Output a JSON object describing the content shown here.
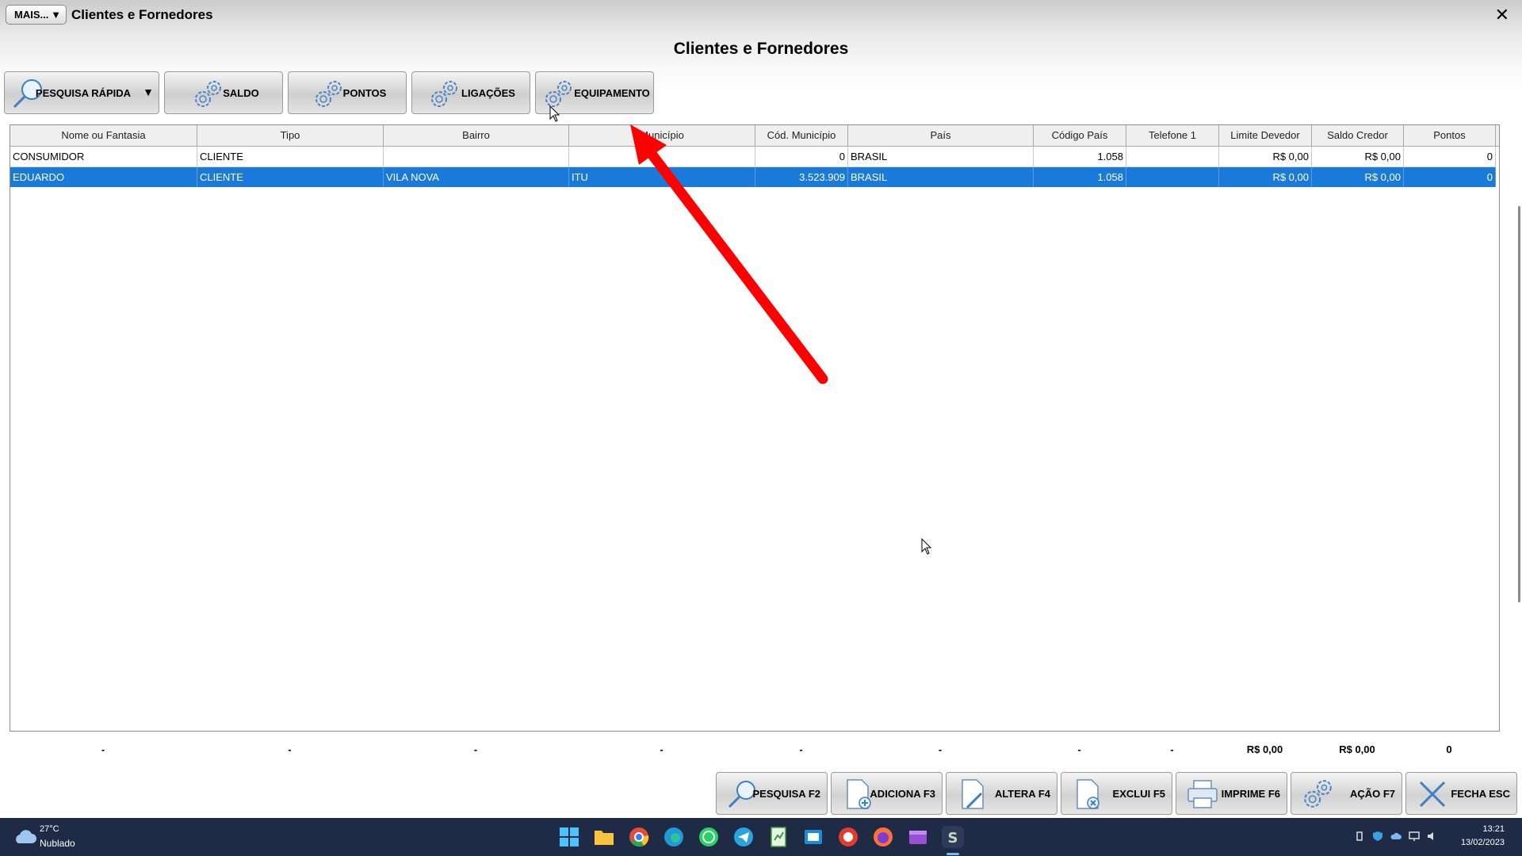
{
  "window": {
    "mais_label": "MAIS...",
    "title": "Clientes e Fornedores",
    "close_symbol": "✕",
    "heading": "Clientes e Fornedores"
  },
  "toolbar": {
    "pesquisa_rapida": "PESQUISA RÁPIDA",
    "saldo": "SALDO",
    "pontos": "PONTOS",
    "ligacoes": "LIGAÇÕES",
    "equipamento": "EQUIPAMENTO",
    "dropdown_symbol": "▼"
  },
  "grid": {
    "columns": [
      "Nome ou Fantasia",
      "Tipo",
      "Bairro",
      "Município",
      "Cód. Município",
      "País",
      "Código País",
      "Telefone 1",
      "Limite Devedor",
      "Saldo Credor",
      "Pontos"
    ],
    "rows": [
      [
        "CONSUMIDOR",
        "CLIENTE",
        "",
        "",
        "0",
        "BRASIL",
        "1.058",
        "",
        "R$ 0,00",
        "R$ 0,00",
        "0"
      ],
      [
        "EDUARDO",
        "CLIENTE",
        "VILA NOVA",
        "ITU",
        "3.523.909",
        "BRASIL",
        "1.058",
        "",
        "R$ 0,00",
        "R$ 0,00",
        "0"
      ]
    ],
    "selected_row": 1
  },
  "totals": [
    "-",
    "-",
    "-",
    "-",
    "-",
    "-",
    "-",
    "-",
    "R$ 0,00",
    "R$ 0,00",
    "0"
  ],
  "actions": {
    "pesquisa": "PESQUISA F2",
    "adiciona": "ADICIONA F3",
    "altera": "ALTERA F4",
    "exclui": "EXCLUI F5",
    "imprime": "IMPRIME F6",
    "acao": "AÇÃO F7",
    "fecha": "FECHA ESC"
  },
  "taskbar": {
    "weather_temp": "27°C",
    "weather_desc": "Nublado",
    "time": "13:21",
    "date": "13/02/2023"
  },
  "colors": {
    "selection": "#1a7ad9",
    "annotation_arrow": "#ff0000",
    "taskbar": "#1f2a44"
  }
}
